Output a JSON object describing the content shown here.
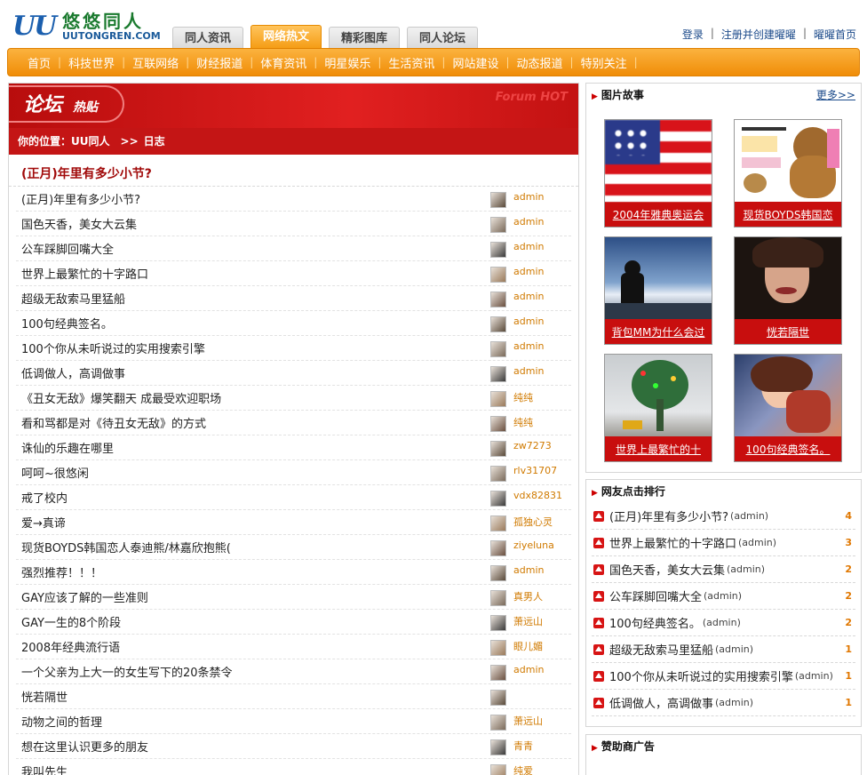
{
  "logo": {
    "mark": "UU",
    "name_cn": "悠悠同人",
    "domain": "UUTONGREN.COM"
  },
  "tabs": [
    {
      "label": "同人资讯",
      "active": false
    },
    {
      "label": "网络热文",
      "active": true
    },
    {
      "label": "精彩图库",
      "active": false
    },
    {
      "label": "同人论坛",
      "active": false
    }
  ],
  "toplinks": {
    "login": "登录",
    "register": "注册并创建曜曜",
    "home": "曜曜首页",
    "sep": "|"
  },
  "nav": [
    "首页",
    "科技世界",
    "互联网络",
    "财经报道",
    "体育资讯",
    "明星娱乐",
    "生活资讯",
    "网站建设",
    "动态报道",
    "特别关注"
  ],
  "banner": {
    "title": "论坛",
    "subtitle": "热贴",
    "english": "Forum HOT"
  },
  "breadcrumb": {
    "prefix": "你的位置：",
    "site": "UU同人",
    "sep": ">>",
    "current": "日志"
  },
  "topic_title": "(正月)年里有多少小节?",
  "posts": [
    {
      "title": "(正月)年里有多少小节?",
      "user": "admin"
    },
    {
      "title": "国色天香，美女大云集",
      "user": "admin"
    },
    {
      "title": "公车踩脚回嘴大全",
      "user": "admin"
    },
    {
      "title": "世界上最繁忙的十字路口",
      "user": "admin"
    },
    {
      "title": "超级无敌索马里猛船",
      "user": "admin"
    },
    {
      "title": "100句经典签名。",
      "user": "admin"
    },
    {
      "title": "100个你从未听说过的实用搜索引擎",
      "user": "admin"
    },
    {
      "title": "低调做人，高调做事",
      "user": "admin"
    },
    {
      "title": "《丑女无敌》爆笑翻天 成最受欢迎职场",
      "user": "纯纯"
    },
    {
      "title": "看和骂都是对《待丑女无敌》的方式",
      "user": "纯纯"
    },
    {
      "title": "诛仙的乐趣在哪里",
      "user": "zw7273"
    },
    {
      "title": "呵呵~很悠闲",
      "user": "rlv31707"
    },
    {
      "title": "戒了校内",
      "user": "vdx82831"
    },
    {
      "title": "爱→真谛",
      "user": "孤独心灵"
    },
    {
      "title": "现货BOYDS韩国恋人泰迪熊/林嘉欣抱熊(",
      "user": "ziyeluna"
    },
    {
      "title": "强烈推荐！！！",
      "user": "admin"
    },
    {
      "title": "GAY应该了解的一些准则",
      "user": "真男人"
    },
    {
      "title": "GAY一生的8个阶段",
      "user": "萧远山"
    },
    {
      "title": "2008年经典流行语",
      "user": "眼儿媚"
    },
    {
      "title": "一个父亲为上大一的女生写下的20条禁令",
      "user": "admin"
    },
    {
      "title": "恍若隔世",
      "user": ""
    },
    {
      "title": "动物之间的哲理",
      "user": "萧远山"
    },
    {
      "title": "想在这里认识更多的朋友",
      "user": "青青"
    },
    {
      "title": "我叫先生",
      "user": "纯爱"
    }
  ],
  "picture_box": {
    "title": "图片故事",
    "more": "更多>>",
    "items": [
      {
        "caption": "2004年雅典奥运会",
        "icon": "flag-photo"
      },
      {
        "caption": "现货BOYDS韩国恋",
        "icon": "teddy-bear-photo"
      },
      {
        "caption": "背包MM为什么会过",
        "icon": "backpacker-photo"
      },
      {
        "caption": "恍若隔世",
        "icon": "portrait-photo"
      },
      {
        "caption": "世界上最繁忙的十",
        "icon": "traffic-light-tree-photo"
      },
      {
        "caption": "100句经典签名。",
        "icon": "anime-girl-photo"
      }
    ]
  },
  "ranking_box": {
    "title": "网友点击排行",
    "items": [
      {
        "title": "(正月)年里有多少小节?",
        "user": "(admin)",
        "count": "4"
      },
      {
        "title": "世界上最繁忙的十字路口",
        "user": "(admin)",
        "count": "3"
      },
      {
        "title": "国色天香，美女大云集",
        "user": "(admin)",
        "count": "2"
      },
      {
        "title": "公车踩脚回嘴大全",
        "user": "(admin)",
        "count": "2"
      },
      {
        "title": "100句经典签名。",
        "user": "(admin)",
        "count": "2"
      },
      {
        "title": "超级无敌索马里猛船",
        "user": "(admin)",
        "count": "1"
      },
      {
        "title": "100个你从未听说过的实用搜索引擎",
        "user": "(admin)",
        "count": "1"
      },
      {
        "title": "低调做人，高调做事",
        "user": "(admin)",
        "count": "1"
      }
    ]
  },
  "sponsor_box": {
    "title": "赞助商广告"
  },
  "colors": {
    "brand_red": "#c41515",
    "nav_orange": "#f49a10",
    "username": "#d07a00"
  }
}
